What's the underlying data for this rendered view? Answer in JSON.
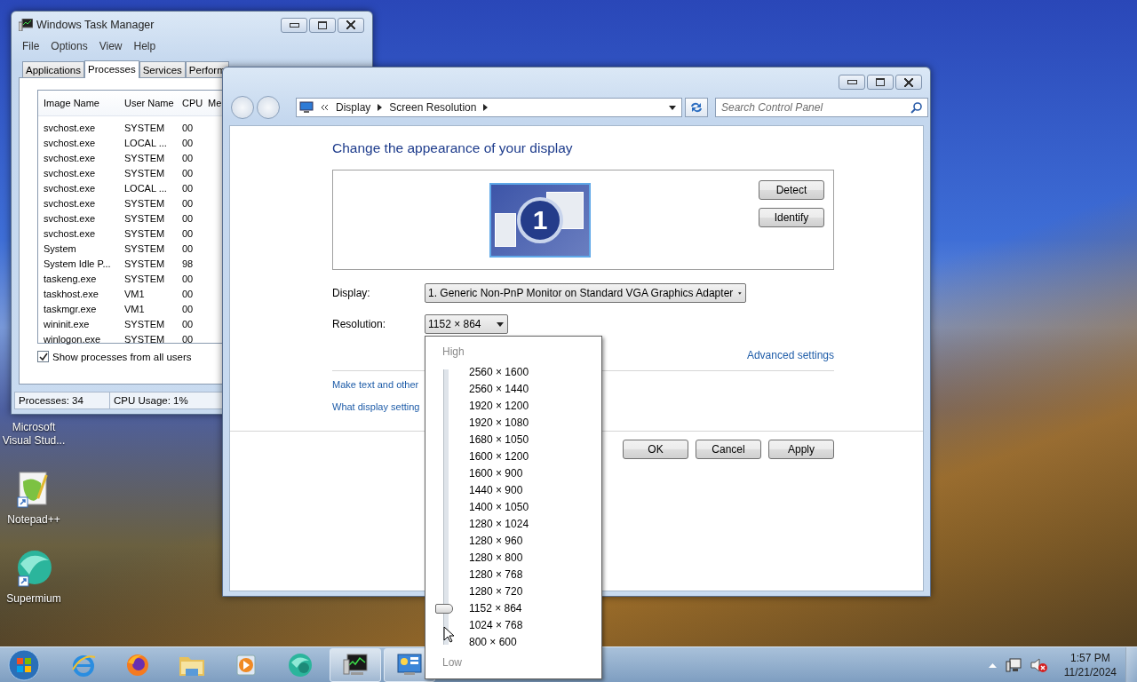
{
  "desktop_icons": [
    {
      "kind": "covered",
      "label": "Microsoft Visual Stud..."
    },
    {
      "kind": "notepad",
      "label": "Notepad++"
    },
    {
      "kind": "sphere",
      "label": "Supermium"
    }
  ],
  "task_manager": {
    "title": "Windows Task Manager",
    "menu": [
      "File",
      "Options",
      "View",
      "Help"
    ],
    "tabs": [
      {
        "label": "Applications",
        "selected": false
      },
      {
        "label": "Processes",
        "selected": true
      },
      {
        "label": "Services",
        "selected": false
      },
      {
        "label": "Perform",
        "selected": false
      }
    ],
    "columns": [
      "Image Name",
      "User Name",
      "CPU",
      "Me"
    ],
    "rows": [
      [
        "svchost.exe",
        "SYSTEM",
        "00"
      ],
      [
        "svchost.exe",
        "LOCAL ...",
        "00"
      ],
      [
        "svchost.exe",
        "SYSTEM",
        "00"
      ],
      [
        "svchost.exe",
        "SYSTEM",
        "00"
      ],
      [
        "svchost.exe",
        "LOCAL ...",
        "00"
      ],
      [
        "svchost.exe",
        "SYSTEM",
        "00"
      ],
      [
        "svchost.exe",
        "SYSTEM",
        "00"
      ],
      [
        "svchost.exe",
        "SYSTEM",
        "00"
      ],
      [
        "System",
        "SYSTEM",
        "00"
      ],
      [
        "System Idle P...",
        "SYSTEM",
        "98"
      ],
      [
        "taskeng.exe",
        "SYSTEM",
        "00"
      ],
      [
        "taskhost.exe",
        "VM1",
        "00"
      ],
      [
        "taskmgr.exe",
        "VM1",
        "00"
      ],
      [
        "wininit.exe",
        "SYSTEM",
        "00"
      ],
      [
        "winlogon.exe",
        "SYSTEM",
        "00"
      ]
    ],
    "show_all": {
      "label": "Show processes from all users",
      "checked": true
    },
    "status": [
      "Processes: 34",
      "CPU Usage: 1%"
    ]
  },
  "display_window": {
    "breadcrumb": [
      "Display",
      "Screen Resolution"
    ],
    "search": {
      "placeholder": "Search Control Panel"
    },
    "heading": "Change the appearance of your display",
    "monitor_number": "1",
    "box_buttons": [
      "Detect",
      "Identify"
    ],
    "display_label": "Display:",
    "display_value": "1. Generic Non-PnP Monitor on Standard VGA Graphics Adapter",
    "resolution_label": "Resolution:",
    "resolution_value": "1152 × 864",
    "advanced_link": "Advanced settings",
    "links": [
      "Make text and other",
      "What display setting"
    ],
    "buttons": [
      "OK",
      "Cancel",
      "Apply"
    ]
  },
  "resolution_menu": {
    "high": "High",
    "low": "Low",
    "level": 0.125,
    "options": [
      "2560 × 1600",
      "2560 × 1440",
      "1920 × 1200",
      "1920 × 1080",
      "1680 × 1050",
      "1600 × 1200",
      "1600 × 900",
      "1440 × 900",
      "1400 × 1050",
      "1280 × 1024",
      "1280 × 960",
      "1280 × 800",
      "1280 × 768",
      "1280 × 720",
      "1152 × 864",
      "1024 × 768",
      "800 × 600"
    ]
  },
  "taskbar": {
    "apps": [
      {
        "kind": "browser-e",
        "open": false
      },
      {
        "kind": "firefox",
        "open": false
      },
      {
        "kind": "folder",
        "open": false
      },
      {
        "kind": "media",
        "open": false
      },
      {
        "kind": "sphere",
        "open": false
      },
      {
        "kind": "task-manager",
        "open": true
      },
      {
        "kind": "control-panel",
        "open": true
      }
    ],
    "tray": {
      "muted": true,
      "time": "1:57 PM",
      "date": "11/21/2024"
    }
  }
}
